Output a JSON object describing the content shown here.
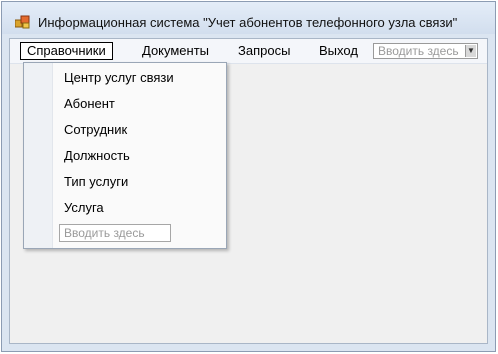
{
  "window": {
    "title": "Информационная система \"Учет абонентов телефонного узла связи\"",
    "icon": "app-icon"
  },
  "menubar": {
    "items": [
      {
        "label": "Справочники",
        "active": true
      },
      {
        "label": "Документы"
      },
      {
        "label": "Запросы"
      },
      {
        "label": "Выход"
      }
    ],
    "placeholder": "Вводить здесь"
  },
  "dropdown": {
    "items": [
      {
        "label": "Центр услуг связи"
      },
      {
        "label": "Абонент"
      },
      {
        "label": "Сотрудник"
      },
      {
        "label": "Должность"
      },
      {
        "label": "Тип услуги"
      },
      {
        "label": "Услуга"
      }
    ],
    "placeholder": "Вводить здесь"
  },
  "colors": {
    "window_frame": "#dbe5f1",
    "client_background": "#f0f0f0"
  }
}
